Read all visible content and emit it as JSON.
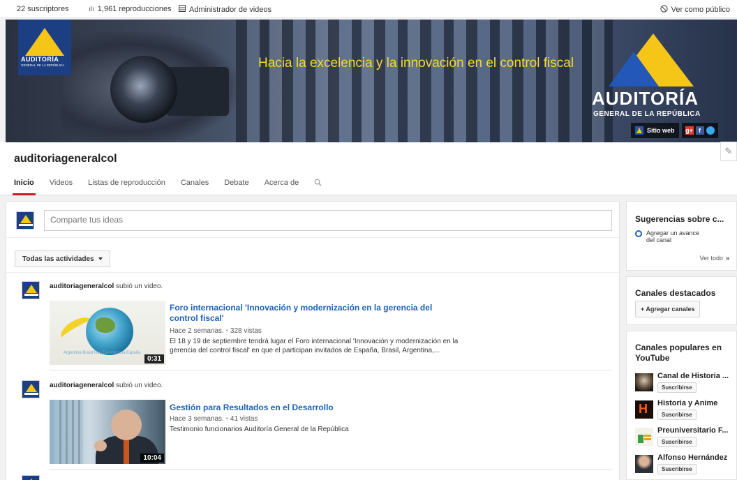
{
  "topbar": {
    "subscribers": "22 suscriptores",
    "views": "1,961 reproducciones",
    "video_manager": "Administrador de videos",
    "view_public": "Ver como público"
  },
  "banner": {
    "slogan": "Hacia la excelencia y la innovación en el control fiscal",
    "logo_small_title": "AUDITORÍA",
    "logo_small_sub": "GENERAL DE LA REPÚBLICA",
    "logo_big_title": "AUDITORÍA",
    "logo_big_sub": "GENERAL DE LA REPÚBLICA",
    "website_label": "Sitio web"
  },
  "channel": {
    "name": "auditoriageneralcol",
    "tabs": [
      "Inicio",
      "Videos",
      "Listas de reproducción",
      "Canales",
      "Debate",
      "Acerca de"
    ],
    "active_tab": 0
  },
  "share": {
    "placeholder": "Comparte tus ideas"
  },
  "filter": {
    "label": "Todas las actividades"
  },
  "feed": [
    {
      "user": "auditoriageneralcol",
      "action": " subió un video.",
      "title": "Foro internacional 'Innovación y modernización en la gerencia del control fiscal'",
      "meta_age": "Hace 2 semanas.",
      "meta_views": "328 vistas",
      "description": "El 18 y 19 de septiembre tendrá lugar el Foro internacional 'Innovación y modernización en la gerencia del control fiscal' en que el participan invitados de España, Brasil, Argentina,...",
      "duration": "0:31",
      "thumb_text": "Argentina Brasil Rep.Dominicana España"
    },
    {
      "user": "auditoriageneralcol",
      "action": " subió un video.",
      "title": "Gestión para Resultados en el Desarrollo",
      "meta_age": "Hace 3 semanas.",
      "meta_views": "41 vistas",
      "description": "Testimonio funcionarios Auditoría General de la República",
      "duration": "10:04"
    }
  ],
  "sidebar": {
    "suggestions": {
      "title": "Sugerencias sobre c...",
      "item": "Agregar un avance del canal",
      "see_all": "Ver todo"
    },
    "featured": {
      "title": "Canales destacados",
      "add_button": "+ Agregar canales"
    },
    "popular": {
      "title": "Canales populares en YouTube",
      "subscribe_label": "Suscribirse",
      "channels": [
        {
          "name": "Canal de Historia ..."
        },
        {
          "name": "Historia y Anime"
        },
        {
          "name": "Preuniversitario F..."
        },
        {
          "name": "Alfonso Hernández"
        }
      ]
    }
  },
  "colors": {
    "accent_red": "#cc181e",
    "link_blue": "#1c62b9",
    "brand_yellow": "#f5c518",
    "brand_blue": "#1c3f84"
  }
}
